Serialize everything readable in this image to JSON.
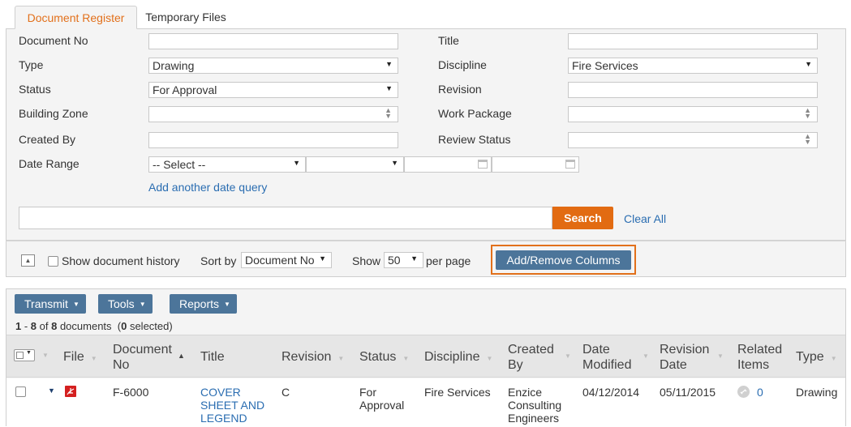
{
  "tabs": [
    {
      "label": "Document Register",
      "active": true
    },
    {
      "label": "Temporary Files",
      "active": false
    }
  ],
  "filters": {
    "document_no": {
      "label": "Document No",
      "value": ""
    },
    "title": {
      "label": "Title",
      "value": ""
    },
    "type": {
      "label": "Type",
      "value": "Drawing"
    },
    "discipline": {
      "label": "Discipline",
      "value": "Fire Services"
    },
    "status": {
      "label": "Status",
      "value": "For Approval"
    },
    "revision": {
      "label": "Revision",
      "value": ""
    },
    "building_zone": {
      "label": "Building Zone",
      "value": ""
    },
    "work_package": {
      "label": "Work Package",
      "value": ""
    },
    "created_by": {
      "label": "Created By",
      "value": ""
    },
    "review_status": {
      "label": "Review Status",
      "value": ""
    },
    "date_range": {
      "label": "Date Range",
      "select_value": "-- Select --",
      "second_select": "",
      "from": "",
      "to": ""
    },
    "add_date_query": "Add another date query"
  },
  "search": {
    "value": "",
    "button_label": "Search",
    "clear_label": "Clear All"
  },
  "options": {
    "show_history_label": "Show document history",
    "show_history_checked": false,
    "sort_by_label": "Sort by",
    "sort_by_value": "Document No",
    "show_label": "Show",
    "show_value": "50",
    "per_page_label": "per page",
    "add_remove_columns": "Add/Remove Columns"
  },
  "toolbar": {
    "transmit": "Transmit",
    "tools": "Tools",
    "reports": "Reports"
  },
  "summary": {
    "from": "1",
    "to": "8",
    "total": "8",
    "selected": "0"
  },
  "columns": {
    "file": "File",
    "document_no": "Document No",
    "title": "Title",
    "revision": "Revision",
    "status": "Status",
    "discipline": "Discipline",
    "created_by": "Created By",
    "date_modified": "Date Modified",
    "revision_date": "Revision Date",
    "related_items": "Related Items",
    "type": "Type"
  },
  "rows": [
    {
      "file_icon": "pdf-icon",
      "document_no": "F-6000",
      "title": "COVER SHEET AND LEGEND",
      "revision": "C",
      "status": "For Approval",
      "discipline": "Fire Services",
      "created_by": "Enzice Consulting Engineers",
      "date_modified": "04/12/2014",
      "revision_date": "05/11/2015",
      "related_items": "0",
      "type": "Drawing"
    }
  ],
  "colors": {
    "accent": "#e2701b",
    "primary_button": "#4c759a",
    "link": "#2a6db1",
    "pdf_red": "#d42020"
  }
}
